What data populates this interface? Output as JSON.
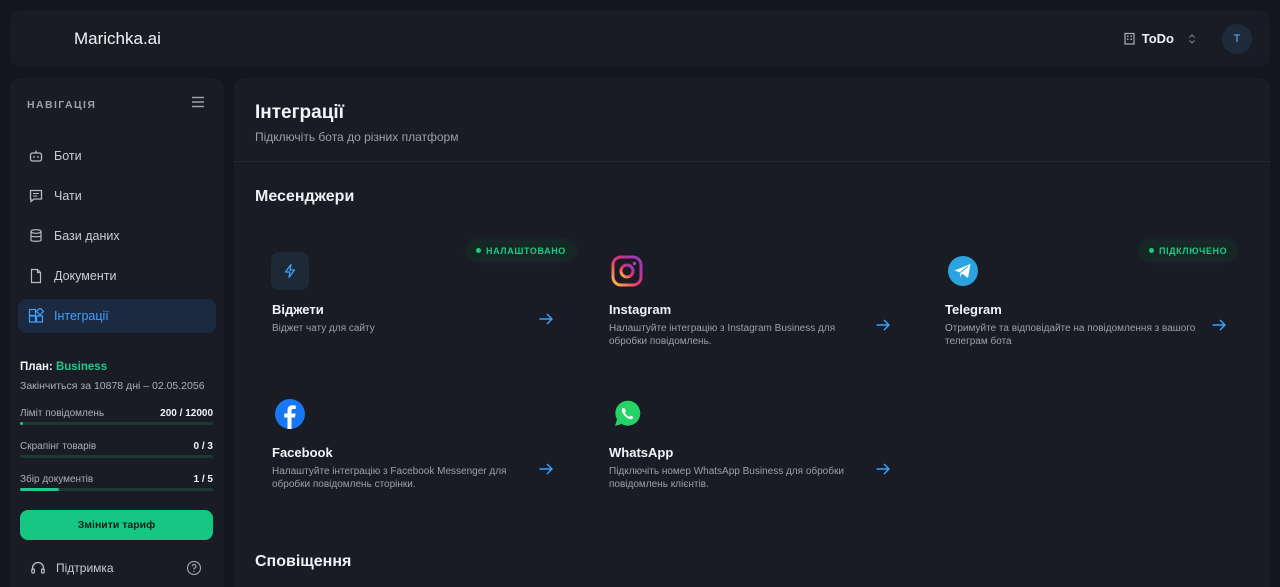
{
  "app": {
    "brand": "Marichka.ai",
    "workspace": "ToDo",
    "avatar_initial": "T"
  },
  "sidebar": {
    "heading": "НАВІГАЦІЯ",
    "items": [
      {
        "label": "Боти",
        "icon": "bot-icon"
      },
      {
        "label": "Чати",
        "icon": "chat-icon"
      },
      {
        "label": "Бази даних",
        "icon": "database-icon"
      },
      {
        "label": "Документи",
        "icon": "document-icon"
      },
      {
        "label": "Інтеграції",
        "icon": "integrations-icon",
        "active": true
      }
    ],
    "plan_label": "План:",
    "plan_name": "Business",
    "expires": "Закінчиться за 10878 дні – 02.05.2056",
    "metrics": [
      {
        "label": "Ліміт повідомлень",
        "value": "200 / 12000",
        "fraction": 0.017
      },
      {
        "label": "Скрапінг товарів",
        "value": "0 / 3",
        "fraction": 0
      },
      {
        "label": "Збір документів",
        "value": "1 / 5",
        "fraction": 0.2
      }
    ],
    "change_plan": "Змінити тариф",
    "support": "Підтримка"
  },
  "main": {
    "title": "Інтеграції",
    "subtitle": "Підключіть бота до різних платформ",
    "section_messengers": "Месенджери",
    "section_notifications": "Сповіщення",
    "cards": [
      {
        "name": "Віджети",
        "desc": "Віджет чату для сайту",
        "badge": "НАЛАШТОВАНО",
        "icon": "lightning-icon"
      },
      {
        "name": "Instagram",
        "desc": "Налаштуйте інтеграцію з Instagram Business для обробки повідомлень.",
        "badge": "",
        "icon": "instagram-icon"
      },
      {
        "name": "Telegram",
        "desc": "Отримуйте та відповідайте на повідомлення з вашого телеграм бота",
        "badge": "ПІДКЛЮЧЕНО",
        "icon": "telegram-icon"
      },
      {
        "name": "Facebook",
        "desc": "Налаштуйте інтеграцію з Facebook Messenger для обробки повідомлень сторінки.",
        "badge": "",
        "icon": "facebook-icon"
      },
      {
        "name": "WhatsApp",
        "desc": "Підключіть номер WhatsApp Business для обробки повідомлень клієнтів.",
        "badge": "",
        "icon": "whatsapp-icon"
      }
    ]
  },
  "colors": {
    "accent": "#1ec98b",
    "active_nav": "#3ea2ff",
    "arrow": "#3ea2ff"
  }
}
